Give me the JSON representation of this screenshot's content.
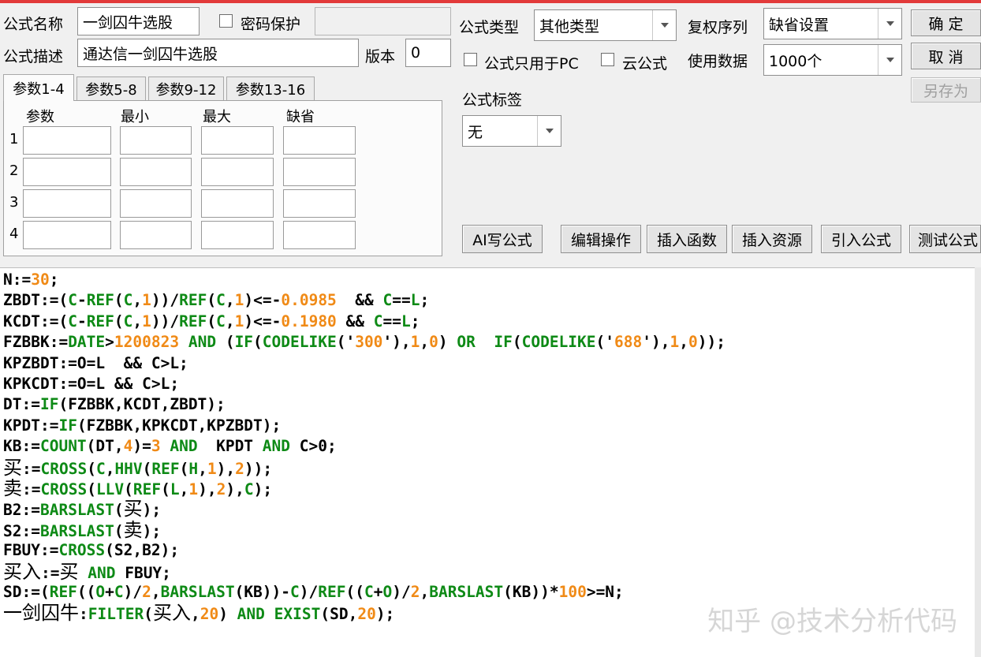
{
  "form": {
    "name_label": "公式名称",
    "name_value": "一剑囚牛选股",
    "password_label": "密码保护",
    "password_value": "",
    "desc_label": "公式描述",
    "desc_value": "通达信一剑囚牛选股",
    "version_label": "版本",
    "version_value": "0",
    "type_label": "公式类型",
    "type_value": "其他类型",
    "restore_label": "复权序列",
    "restore_value": "缺省设置",
    "pc_only_label": "公式只用于PC",
    "cloud_label": "云公式",
    "data_label": "使用数据",
    "data_value": "1000个",
    "tag_label": "公式标签",
    "tag_value": "无"
  },
  "buttons": {
    "ok": "确  定",
    "cancel": "取  消",
    "save_as": "另存为",
    "ai": "AI写公式",
    "edit": "编辑操作",
    "insert_func": "插入函数",
    "insert_res": "插入资源",
    "import": "引入公式",
    "test": "测试公式"
  },
  "tabs": [
    "参数1-4",
    "参数5-8",
    "参数9-12",
    "参数13-16"
  ],
  "param_headers": [
    "参数",
    "最小",
    "最大",
    "缺省"
  ],
  "param_rows": [
    "1",
    "2",
    "3",
    "4"
  ],
  "code_lines": [
    [
      [
        "d",
        "N:="
      ],
      [
        "n",
        "30"
      ],
      [
        "d",
        ";"
      ]
    ],
    [
      [
        "d",
        "ZBDT:=("
      ],
      [
        "f",
        "C"
      ],
      [
        "d",
        "-"
      ],
      [
        "f",
        "REF"
      ],
      [
        "d",
        "("
      ],
      [
        "f",
        "C"
      ],
      [
        "d",
        ","
      ],
      [
        "n",
        "1"
      ],
      [
        "d",
        "))/"
      ],
      [
        "f",
        "REF"
      ],
      [
        "d",
        "("
      ],
      [
        "f",
        "C"
      ],
      [
        "d",
        ","
      ],
      [
        "n",
        "1"
      ],
      [
        "d",
        ")<=-"
      ],
      [
        "n",
        "0.0985"
      ],
      [
        "d",
        "  && "
      ],
      [
        "f",
        "C"
      ],
      [
        "d",
        "=="
      ],
      [
        "f",
        "L"
      ],
      [
        "d",
        ";"
      ]
    ],
    [
      [
        "d",
        "KCDT:=("
      ],
      [
        "f",
        "C"
      ],
      [
        "d",
        "-"
      ],
      [
        "f",
        "REF"
      ],
      [
        "d",
        "("
      ],
      [
        "f",
        "C"
      ],
      [
        "d",
        ","
      ],
      [
        "n",
        "1"
      ],
      [
        "d",
        "))/"
      ],
      [
        "f",
        "REF"
      ],
      [
        "d",
        "("
      ],
      [
        "f",
        "C"
      ],
      [
        "d",
        ","
      ],
      [
        "n",
        "1"
      ],
      [
        "d",
        ")<=-"
      ],
      [
        "n",
        "0.1980"
      ],
      [
        "d",
        " && "
      ],
      [
        "f",
        "C"
      ],
      [
        "d",
        "=="
      ],
      [
        "f",
        "L"
      ],
      [
        "d",
        ";"
      ]
    ],
    [
      [
        "d",
        "FZBBK:="
      ],
      [
        "f",
        "DATE"
      ],
      [
        "d",
        ">"
      ],
      [
        "n",
        "1200823"
      ],
      [
        "d",
        " "
      ],
      [
        "f",
        "AND"
      ],
      [
        "d",
        " ("
      ],
      [
        "f",
        "IF"
      ],
      [
        "d",
        "("
      ],
      [
        "f",
        "CODELIKE"
      ],
      [
        "d",
        "('"
      ],
      [
        "n",
        "300"
      ],
      [
        "d",
        "'),"
      ],
      [
        "n",
        "1"
      ],
      [
        "d",
        ","
      ],
      [
        "n",
        "0"
      ],
      [
        "d",
        ") "
      ],
      [
        "f",
        "OR"
      ],
      [
        "d",
        "  "
      ],
      [
        "f",
        "IF"
      ],
      [
        "d",
        "("
      ],
      [
        "f",
        "CODELIKE"
      ],
      [
        "d",
        "('"
      ],
      [
        "n",
        "688"
      ],
      [
        "d",
        "'),"
      ],
      [
        "n",
        "1"
      ],
      [
        "d",
        ","
      ],
      [
        "n",
        "0"
      ],
      [
        "d",
        "));"
      ]
    ],
    [
      [
        "d",
        "KPZBDT:=O=L  && C>L;"
      ]
    ],
    [
      [
        "d",
        "KPKCDT:=O=L && C>L;"
      ]
    ],
    [
      [
        "d",
        "DT:="
      ],
      [
        "f",
        "IF"
      ],
      [
        "d",
        "(FZBBK,KCDT,ZBDT);"
      ]
    ],
    [
      [
        "d",
        "KPDT:="
      ],
      [
        "f",
        "IF"
      ],
      [
        "d",
        "(FZBBK,KPKCDT,KPZBDT);"
      ]
    ],
    [
      [
        "d",
        "KB:="
      ],
      [
        "f",
        "COUNT"
      ],
      [
        "d",
        "(DT,"
      ],
      [
        "n",
        "4"
      ],
      [
        "d",
        ")="
      ],
      [
        "n",
        "3"
      ],
      [
        "d",
        " "
      ],
      [
        "f",
        "AND"
      ],
      [
        "d",
        "  KPDT "
      ],
      [
        "f",
        "AND"
      ],
      [
        "d",
        " C>0;"
      ]
    ],
    [
      [
        "c",
        "买"
      ],
      [
        "d",
        ":="
      ],
      [
        "f",
        "CROSS"
      ],
      [
        "d",
        "("
      ],
      [
        "f",
        "C"
      ],
      [
        "d",
        ","
      ],
      [
        "f",
        "HHV"
      ],
      [
        "d",
        "("
      ],
      [
        "f",
        "REF"
      ],
      [
        "d",
        "("
      ],
      [
        "f",
        "H"
      ],
      [
        "d",
        ","
      ],
      [
        "n",
        "1"
      ],
      [
        "d",
        "),"
      ],
      [
        "n",
        "2"
      ],
      [
        "d",
        "));"
      ]
    ],
    [
      [
        "c",
        "卖"
      ],
      [
        "d",
        ":="
      ],
      [
        "f",
        "CROSS"
      ],
      [
        "d",
        "("
      ],
      [
        "f",
        "LLV"
      ],
      [
        "d",
        "("
      ],
      [
        "f",
        "REF"
      ],
      [
        "d",
        "("
      ],
      [
        "f",
        "L"
      ],
      [
        "d",
        ","
      ],
      [
        "n",
        "1"
      ],
      [
        "d",
        "),"
      ],
      [
        "n",
        "2"
      ],
      [
        "d",
        "),"
      ],
      [
        "f",
        "C"
      ],
      [
        "d",
        ");"
      ]
    ],
    [
      [
        "d",
        "B2:="
      ],
      [
        "f",
        "BARSLAST"
      ],
      [
        "d",
        "("
      ],
      [
        "c",
        "买"
      ],
      [
        "d",
        ");"
      ]
    ],
    [
      [
        "d",
        "S2:="
      ],
      [
        "f",
        "BARSLAST"
      ],
      [
        "d",
        "("
      ],
      [
        "c",
        "卖"
      ],
      [
        "d",
        ");"
      ]
    ],
    [
      [
        "d",
        "FBUY:="
      ],
      [
        "f",
        "CROSS"
      ],
      [
        "d",
        "(S2,B2);"
      ]
    ],
    [
      [
        "c",
        "买入"
      ],
      [
        "d",
        ":="
      ],
      [
        "c",
        "买"
      ],
      [
        "d",
        " "
      ],
      [
        "f",
        "AND"
      ],
      [
        "d",
        " FBUY;"
      ]
    ],
    [
      [
        "d",
        "SD:=("
      ],
      [
        "f",
        "REF"
      ],
      [
        "d",
        "(("
      ],
      [
        "f",
        "O"
      ],
      [
        "d",
        "+"
      ],
      [
        "f",
        "C"
      ],
      [
        "d",
        ")/"
      ],
      [
        "n",
        "2"
      ],
      [
        "d",
        ","
      ],
      [
        "f",
        "BARSLAST"
      ],
      [
        "d",
        "(KB))-"
      ],
      [
        "f",
        "C"
      ],
      [
        "d",
        ")/"
      ],
      [
        "f",
        "REF"
      ],
      [
        "d",
        "(("
      ],
      [
        "f",
        "C"
      ],
      [
        "d",
        "+"
      ],
      [
        "f",
        "O"
      ],
      [
        "d",
        ")/"
      ],
      [
        "n",
        "2"
      ],
      [
        "d",
        ","
      ],
      [
        "f",
        "BARSLAST"
      ],
      [
        "d",
        "(KB))*"
      ],
      [
        "n",
        "100"
      ],
      [
        "d",
        ">=N;"
      ]
    ],
    [
      [
        "c",
        "一剑囚牛"
      ],
      [
        "d",
        ":"
      ],
      [
        "f",
        "FILTER"
      ],
      [
        "d",
        "("
      ],
      [
        "c",
        "买入"
      ],
      [
        "d",
        ","
      ],
      [
        "n",
        "20"
      ],
      [
        "d",
        ") "
      ],
      [
        "f",
        "AND"
      ],
      [
        "d",
        " "
      ],
      [
        "f",
        "EXIST"
      ],
      [
        "d",
        "(SD,"
      ],
      [
        "n",
        "20"
      ],
      [
        "d",
        ");"
      ]
    ]
  ],
  "watermark": "知乎 @技术分析代码",
  "colors": {
    "keyword": "#0e8a16",
    "number": "#f08a16",
    "default": "#000000",
    "accent_line": "#e23a3a"
  }
}
